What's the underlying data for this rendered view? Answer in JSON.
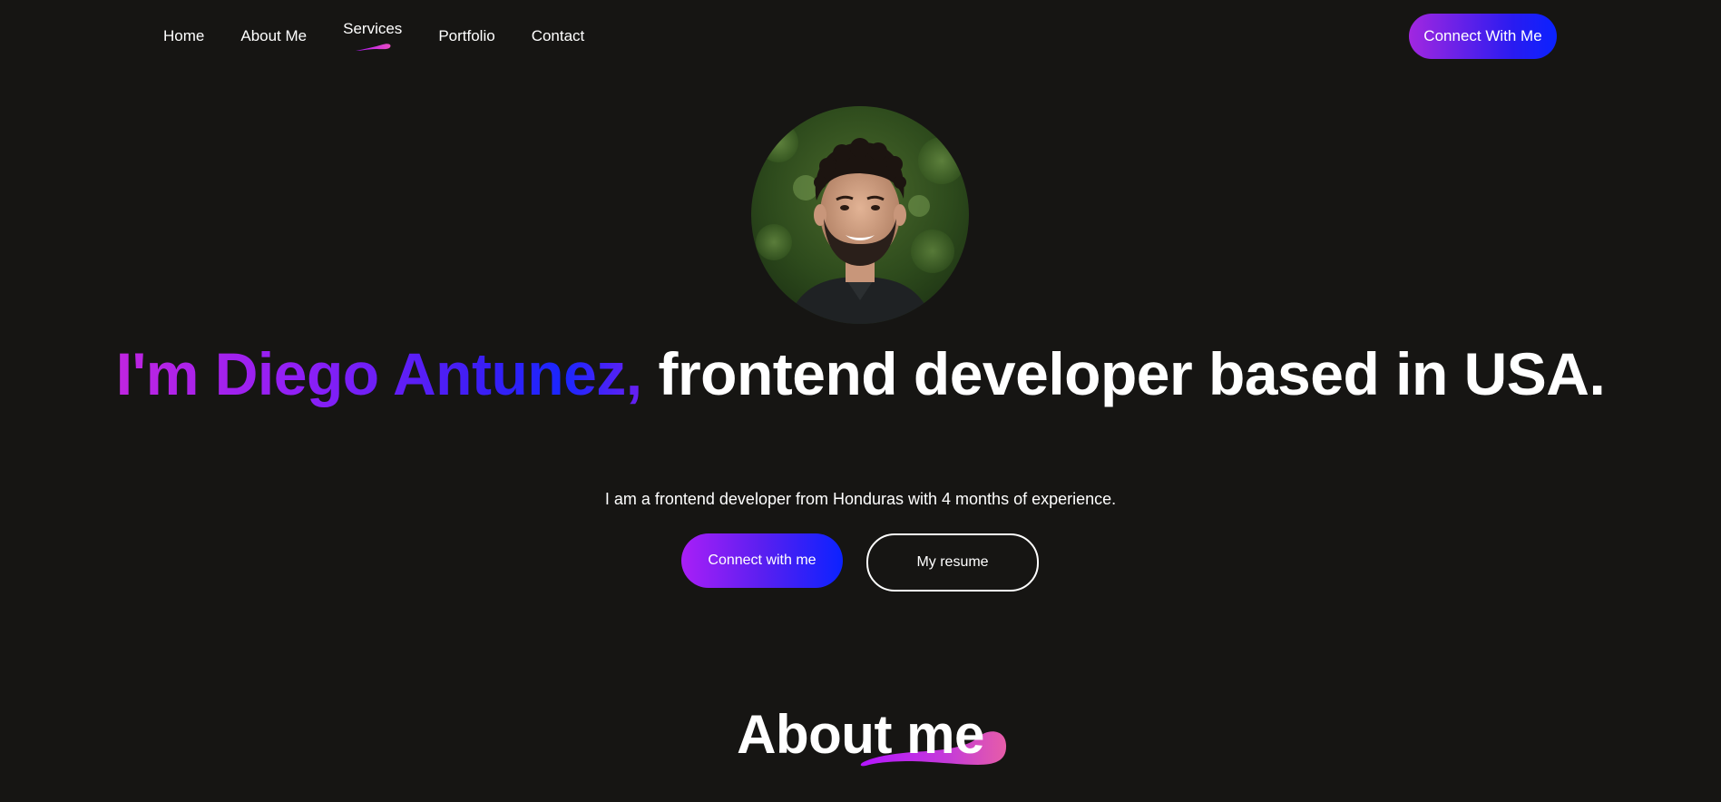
{
  "nav": {
    "items": [
      {
        "label": "Home"
      },
      {
        "label": "About Me"
      },
      {
        "label": "Services"
      },
      {
        "label": "Portfolio"
      },
      {
        "label": "Contact"
      }
    ],
    "active_index": 2,
    "cta_label": "Connect With Me"
  },
  "hero": {
    "name_text": "I'm Diego Antunez,",
    "title_rest": " frontend developer based in USA.",
    "subtitle": "I am a frontend developer from Honduras with 4 months of experience.",
    "primary_button": "Connect with me",
    "secondary_button": "My resume"
  },
  "about": {
    "heading": "About me"
  },
  "colors": {
    "background": "#161513",
    "accent_purple": "#b415ff",
    "accent_blue": "#0b22ff",
    "accent_pink": "#df8908"
  }
}
